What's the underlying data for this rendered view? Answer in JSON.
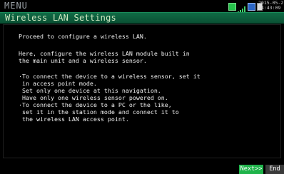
{
  "header": {
    "menu_label": "MENU",
    "date": "2015-05-2",
    "time": "14:43:09",
    "icons": [
      "green-device-icon",
      "wifi-signal-icon",
      "card-icon",
      "battery-icon"
    ]
  },
  "titlebar": {
    "title": "Wireless LAN Settings"
  },
  "content": {
    "para1": "Proceed to configure a wireless LAN.",
    "para2_line1": "Here, configure the wireless LAN module built in",
    "para2_line2": "the main unit and a wireless sensor.",
    "bullet1_line1": "·To connect the device to a wireless sensor, set it",
    "bullet1_line2": " in access point mode.",
    "bullet1_line3": " Set only one device at this navigation.",
    "bullet1_line4": " Have only one wireless sensor powered on.",
    "bullet2_line1": "·To connect the device to a PC or the like,",
    "bullet2_line2": " set it in the station mode and connect it to",
    "bullet2_line3": " the wireless LAN access point."
  },
  "footer": {
    "next_label": "Next>>",
    "end_label": "End"
  },
  "colors": {
    "titlebar": "#0a5a3a",
    "title_text": "#cfe9c2",
    "next_button": "#1fb34a",
    "end_button": "#3a3a3a"
  }
}
